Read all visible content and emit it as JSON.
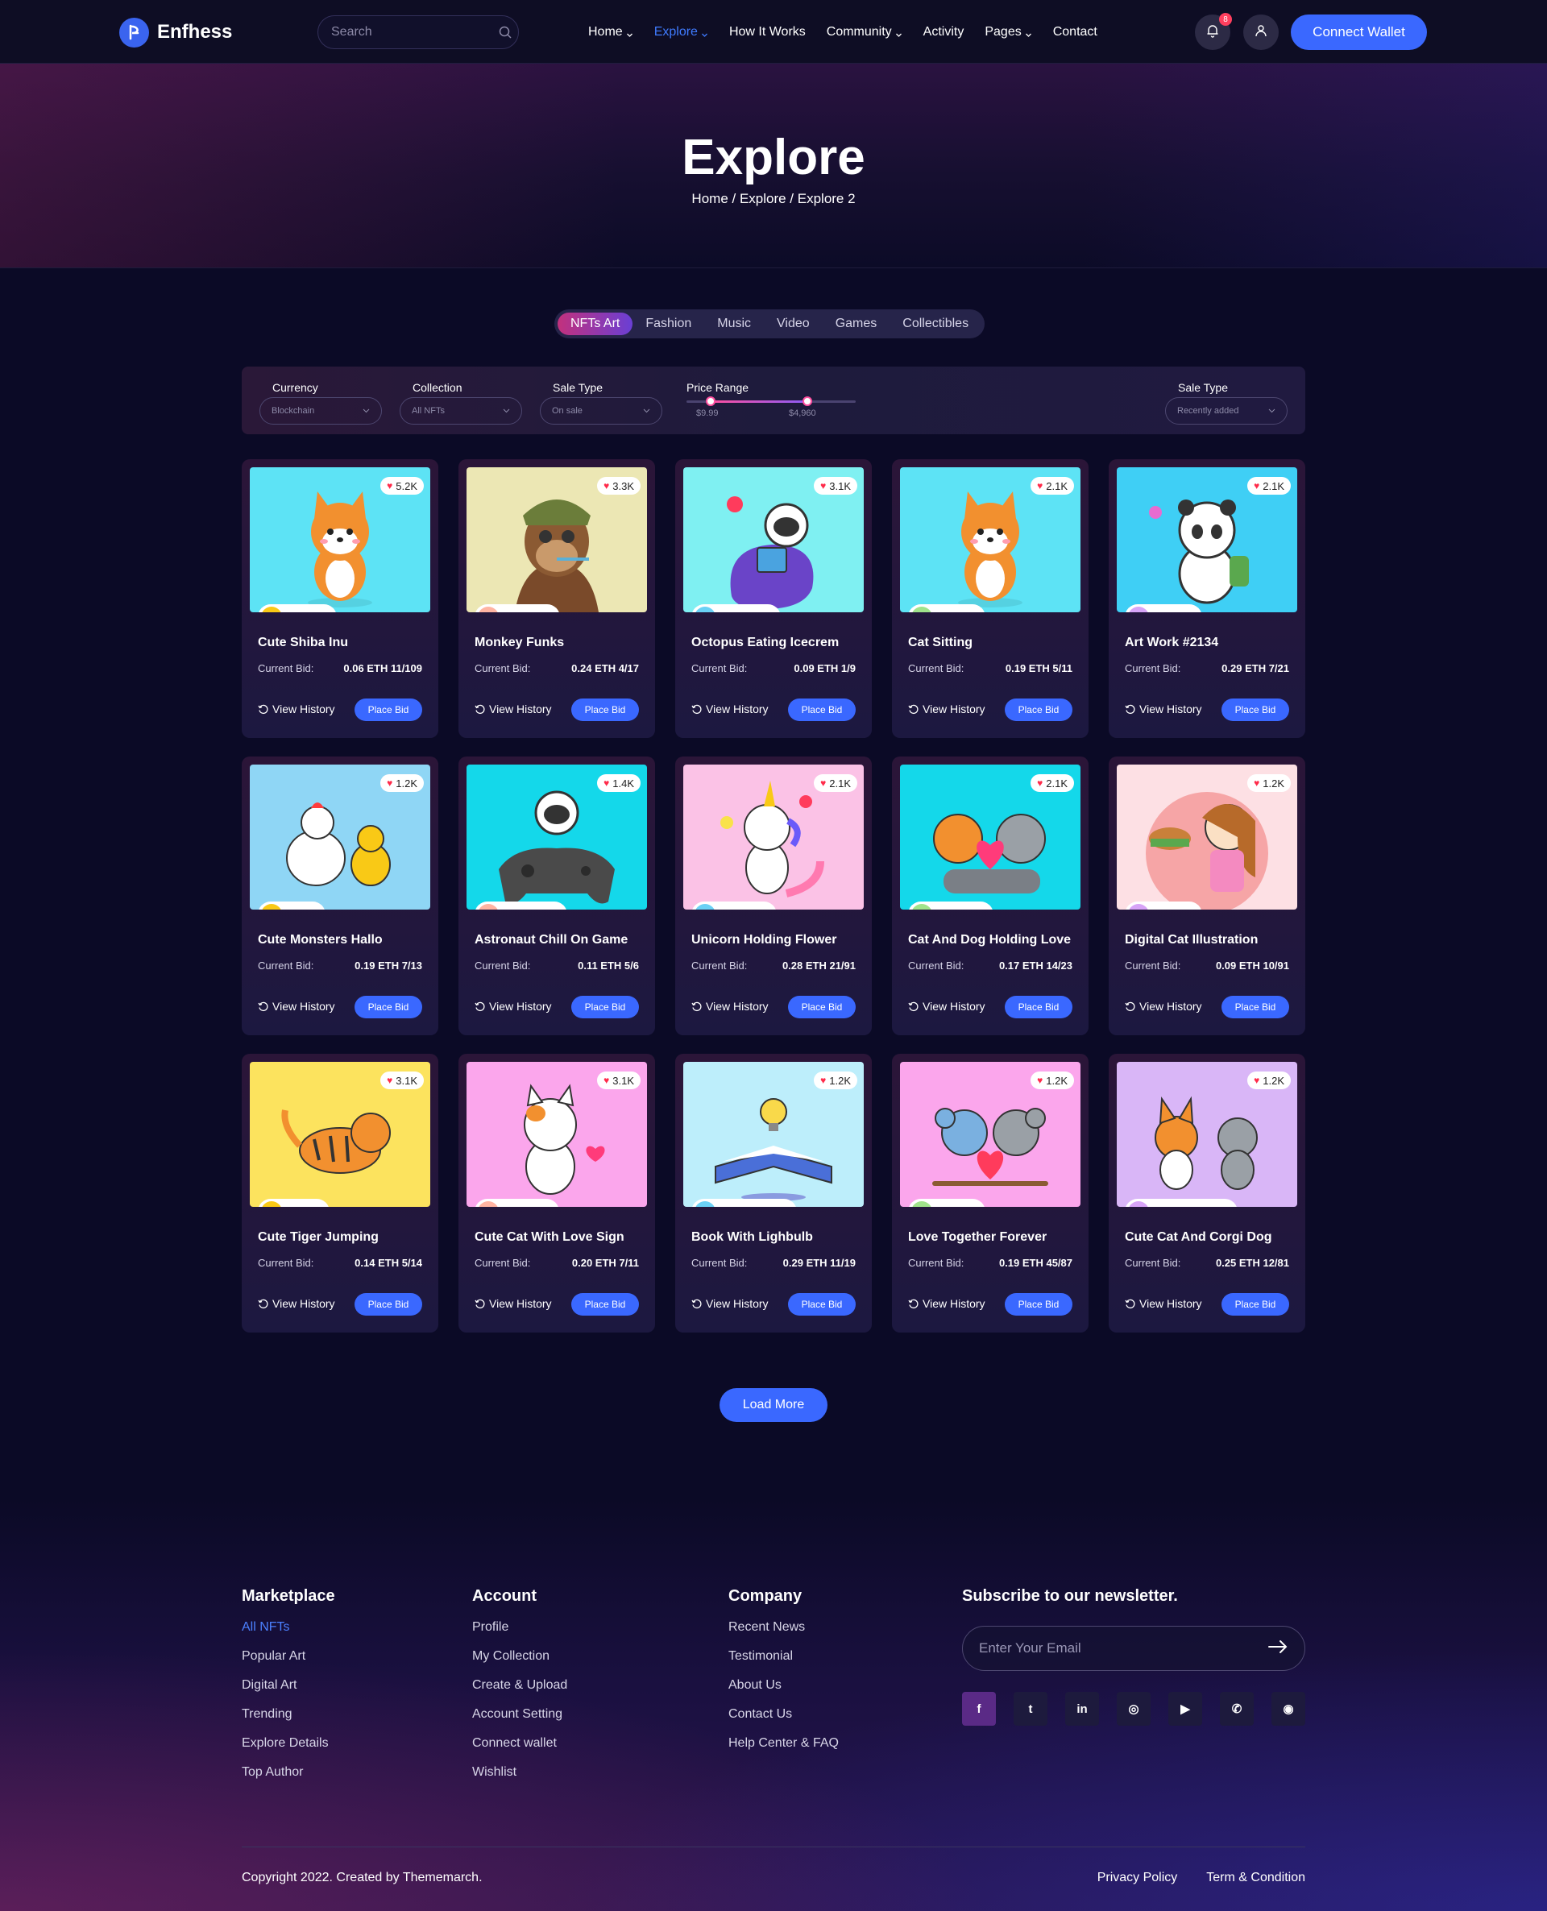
{
  "brand": {
    "name": "Enfhess"
  },
  "search": {
    "placeholder": "Search"
  },
  "nav": {
    "items": [
      {
        "label": "Home",
        "dropdown": true,
        "active": false
      },
      {
        "label": "Explore",
        "dropdown": true,
        "active": true
      },
      {
        "label": "How It Works",
        "dropdown": false,
        "active": false
      },
      {
        "label": "Community",
        "dropdown": true,
        "active": false
      },
      {
        "label": "Activity",
        "dropdown": false,
        "active": false
      },
      {
        "label": "Pages",
        "dropdown": true,
        "active": false
      },
      {
        "label": "Contact",
        "dropdown": false,
        "active": false
      }
    ],
    "notification_count": "8",
    "connect_label": "Connect Wallet"
  },
  "hero": {
    "title": "Explore",
    "breadcrumb": "Home / Explore / Explore 2"
  },
  "tabs": [
    "NFTs Art",
    "Fashion",
    "Music",
    "Video",
    "Games",
    "Collectibles"
  ],
  "active_tab": "NFTs Art",
  "filters": {
    "currency": {
      "label": "Currency",
      "value": "Blockchain"
    },
    "collection": {
      "label": "Collection",
      "value": "All NFTs"
    },
    "sale_type": {
      "label": "Sale Type",
      "value": "On sale"
    },
    "price_range": {
      "label": "Price Range",
      "min": "$9.99",
      "max": "$4,960"
    },
    "sort": {
      "label": "Sale Type",
      "value": "Recently added"
    }
  },
  "card_labels": {
    "current_bid": "Current Bid:",
    "view_history": "View History",
    "place_bid": "Place Bid"
  },
  "cards": [
    {
      "title": "Cute Shiba Inu",
      "bid": "0.06 ETH 11/109",
      "likes": "5.2K",
      "owner": "gallant j.",
      "bg": "#5de3f5",
      "art": "shiba-illustration"
    },
    {
      "title": "Monkey Funks",
      "bid": "0.24 ETH 4/17",
      "likes": "3.3K",
      "owner": "debit alex",
      "bg": "#ece7b4",
      "art": "ape-illustration"
    },
    {
      "title": "Octopus Eating Icecrem",
      "bid": "0.09 ETH 1/9",
      "likes": "3.1K",
      "owner": "robert alex",
      "bg": "#7ff0f2",
      "art": "astronaut-reading-illustration"
    },
    {
      "title": "Cat Sitting",
      "bid": "0.19 ETH 5/11",
      "likes": "2.1K",
      "owner": "johny e.",
      "bg": "#5de3f5",
      "art": "shiba-illustration"
    },
    {
      "title": "Art Work #2134",
      "bid": "0.29 ETH 7/21",
      "likes": "2.1K",
      "owner": "johny e.",
      "bg": "#3fcff5",
      "art": "panda-illustration"
    },
    {
      "title": "Cute Monsters Hallo",
      "bid": "0.19 ETH 7/13",
      "likes": "1.2K",
      "owner": "robert",
      "bg": "#8fd6f5",
      "art": "chicken-illustration"
    },
    {
      "title": "Astronaut Chill On Game",
      "bid": "0.11 ETH 5/6",
      "likes": "1.4K",
      "owner": "john powell",
      "bg": "#14d8ea",
      "art": "astronaut-game-illustration"
    },
    {
      "title": "Unicorn Holding Flower",
      "bid": "0.28 ETH 21/91",
      "likes": "2.1K",
      "owner": "debit alex",
      "bg": "#fbc2e6",
      "art": "unicorn-illustration"
    },
    {
      "title": "Cat And Dog Holding Love",
      "bid": "0.17 ETH 14/23",
      "likes": "2.1K",
      "owner": "debit alex",
      "bg": "#14d8ea",
      "art": "cat-dog-love-illustration"
    },
    {
      "title": "Digital Cat Illustration",
      "bid": "0.09 ETH 10/91",
      "likes": "1.2K",
      "owner": "austin r.",
      "bg": "#fde0e4",
      "art": "girl-burger-illustration"
    },
    {
      "title": "Cute Tiger Jumping",
      "bid": "0.14 ETH 5/14",
      "likes": "3.1K",
      "owner": "mark j.",
      "bg": "#fce35e",
      "art": "tiger-illustration"
    },
    {
      "title": "Cute Cat With Love Sign",
      "bid": "0.20 ETH 7/11",
      "likes": "3.1K",
      "owner": "michael l.",
      "bg": "#fba6ec",
      "art": "cat-heart-illustration"
    },
    {
      "title": "Book With Lighbulb",
      "bid": "0.29 ETH 11/19",
      "likes": "1.2K",
      "owner": "edward prisco",
      "bg": "#bdeefb",
      "art": "book-bulb-illustration"
    },
    {
      "title": "Love Together Forever",
      "bid": "0.19 ETH 45/87",
      "likes": "1.2K",
      "owner": "austin r.",
      "bg": "#fba6ec",
      "art": "koala-heart-illustration"
    },
    {
      "title": "Cute Cat And Corgi Dog",
      "bid": "0.25 ETH 12/81",
      "likes": "1.2K",
      "owner": "duncan helmick",
      "bg": "#d9b6f7",
      "art": "corgi-cat-illustration"
    }
  ],
  "load_more": "Load More",
  "footer": {
    "columns": [
      {
        "title": "Marketplace",
        "links": [
          "All NFTs",
          "Popular Art",
          "Digital Art",
          "Trending",
          "Explore Details",
          "Top Author"
        ],
        "active": "All NFTs"
      },
      {
        "title": "Account",
        "links": [
          "Profile",
          "My Collection",
          "Create & Upload",
          "Account Setting",
          "Connect wallet",
          "Wishlist"
        ]
      },
      {
        "title": "Company",
        "links": [
          "Recent News",
          "Testimonial",
          "About Us",
          "Contact Us",
          "Help Center & FAQ"
        ]
      }
    ],
    "newsletter": {
      "title": "Subscribe to our newsletter.",
      "placeholder": "Enter Your Email"
    },
    "socials": [
      {
        "icon": "facebook-icon",
        "glyph": "f"
      },
      {
        "icon": "twitter-icon",
        "glyph": "t"
      },
      {
        "icon": "linkedin-icon",
        "glyph": "in"
      },
      {
        "icon": "instagram-icon",
        "glyph": "◎"
      },
      {
        "icon": "youtube-icon",
        "glyph": "▶"
      },
      {
        "icon": "whatsapp-icon",
        "glyph": "✆"
      },
      {
        "icon": "github-icon",
        "glyph": "◉"
      }
    ],
    "copyright": "Copyright 2022. Created by Thememarch.",
    "legal": [
      "Privacy Policy",
      "Term & Condition"
    ]
  },
  "colors": {
    "accent": "#3a68ff",
    "active_link": "#4b80ff",
    "background": "#0b0a26"
  }
}
